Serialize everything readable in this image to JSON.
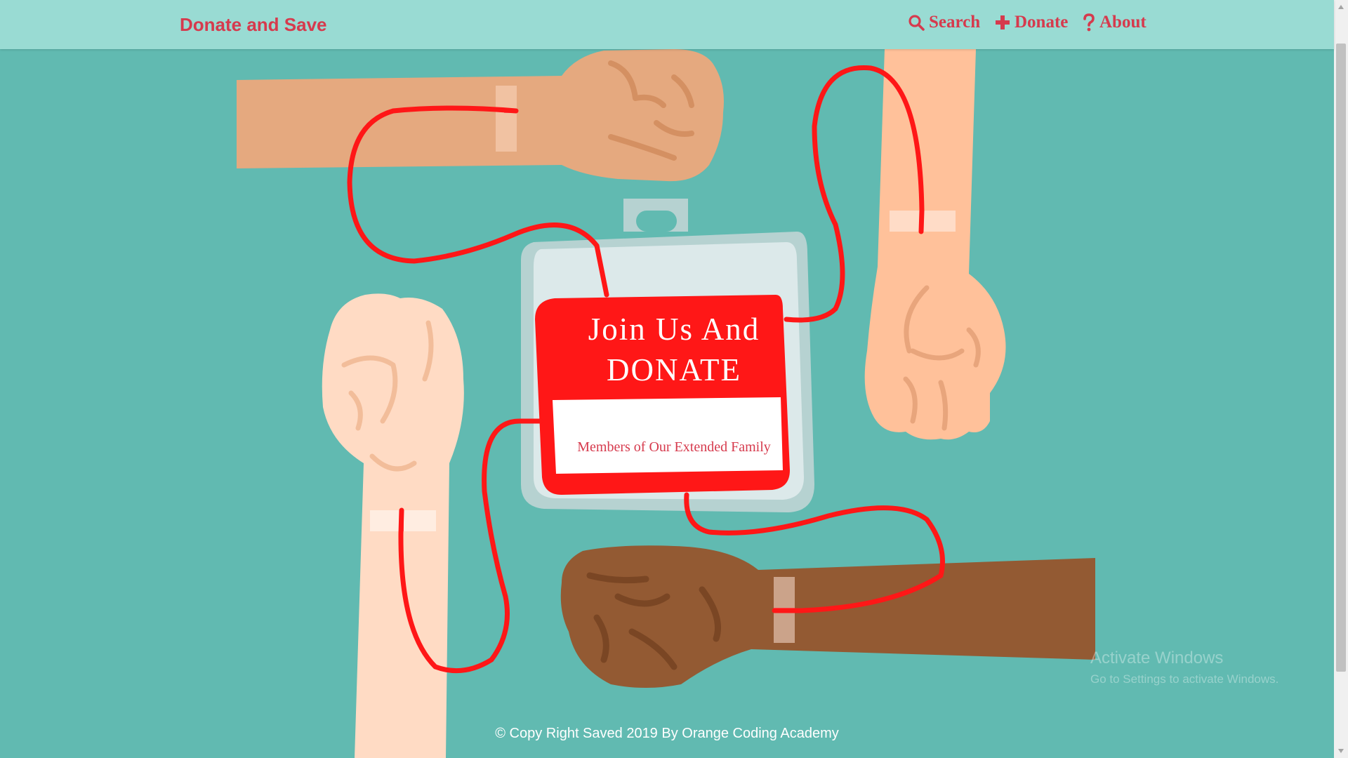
{
  "app": {
    "brand": "Donate and Save"
  },
  "nav": {
    "search": "Search",
    "donate": "Donate",
    "about": "About",
    "search_icon": "search-icon",
    "donate_icon": "plus-icon",
    "about_icon": "question-icon"
  },
  "hero": {
    "title_line1": "Join Us And",
    "title_line2": "DONATE",
    "subtitle": "Members of Our Extended Family"
  },
  "footer": {
    "text": "© Copy Right Saved 2019 By Orange Coding Academy"
  },
  "watermark": {
    "line1": "Activate Windows",
    "line2": "Go to Settings to activate Windows."
  },
  "colors": {
    "background": "#61bab1",
    "navbar": "#99dbd3",
    "accent": "#d63a4d",
    "blood": "#ff1717"
  }
}
